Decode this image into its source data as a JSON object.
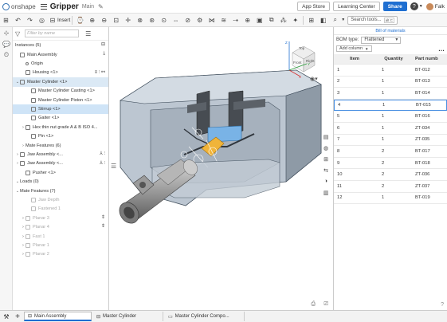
{
  "app": {
    "logo": "onshape",
    "doc_title": "Gripper",
    "branch": "Main"
  },
  "topbar": {
    "app_store": "App Store",
    "learning_center": "Learning Center",
    "share": "Share",
    "help": "?",
    "user": "Falk"
  },
  "toolbar": {
    "insert_label": "Insert",
    "search_placeholder": "Search tools...",
    "search_shortcut": "alt C"
  },
  "tree": {
    "header": "Instances (5)",
    "filter_placeholder": "Filter by name",
    "rows": [
      {
        "label": "Main Assembly",
        "indent": 0,
        "caret": "",
        "kind": "asm",
        "dim": false,
        "sel": false,
        "hl": false
      },
      {
        "label": "Origin",
        "indent": 1,
        "caret": "",
        "kind": "origin",
        "dim": false,
        "sel": false,
        "hl": false
      },
      {
        "label": "Housing <1>",
        "indent": 1,
        "caret": "",
        "kind": "part",
        "dim": false,
        "sel": false,
        "hl": false
      },
      {
        "label": "Master Cylinder <1>",
        "indent": 0,
        "caret": "v",
        "kind": "asm",
        "dim": false,
        "sel": false,
        "hl": true
      },
      {
        "label": "Master Cylinder Casting <1>",
        "indent": 2,
        "caret": "",
        "kind": "part",
        "dim": false,
        "sel": false,
        "hl": false
      },
      {
        "label": "Master Cylinder Piston <1>",
        "indent": 2,
        "caret": "",
        "kind": "part",
        "dim": false,
        "sel": false,
        "hl": false
      },
      {
        "label": "Stirrup <1>",
        "indent": 2,
        "caret": "",
        "kind": "part",
        "dim": false,
        "sel": true,
        "hl": false
      },
      {
        "label": "Gaiter <1>",
        "indent": 2,
        "caret": "",
        "kind": "part",
        "dim": false,
        "sel": false,
        "hl": false
      },
      {
        "label": "Hex thin nut grade A & B ISO 4...",
        "indent": 1,
        "caret": ">",
        "kind": "asm",
        "dim": false,
        "sel": false,
        "hl": false
      },
      {
        "label": "Pin <1>",
        "indent": 2,
        "caret": "",
        "kind": "part",
        "dim": false,
        "sel": false,
        "hl": false
      },
      {
        "label": "Mate Features (6)",
        "indent": 1,
        "caret": ">",
        "kind": "folder",
        "dim": false,
        "sel": false,
        "hl": false
      },
      {
        "label": "Jaw Assembly <...",
        "indent": 0,
        "caret": ">",
        "kind": "asm",
        "dim": false,
        "sel": false,
        "hl": false
      },
      {
        "label": "Jaw Assembly <...",
        "indent": 0,
        "caret": ">",
        "kind": "asm",
        "dim": false,
        "sel": false,
        "hl": false
      },
      {
        "label": "Pusher <1>",
        "indent": 1,
        "caret": "",
        "kind": "part",
        "dim": false,
        "sel": false,
        "hl": false
      },
      {
        "label": "Loads (0)",
        "indent": 0,
        "caret": "v",
        "kind": "folder",
        "dim": false,
        "sel": false,
        "hl": false
      },
      {
        "label": "Mate Features (7)",
        "indent": 0,
        "caret": "v",
        "kind": "folder",
        "dim": false,
        "sel": false,
        "hl": false
      },
      {
        "label": "Jaw Depth",
        "indent": 2,
        "caret": "",
        "kind": "mate",
        "dim": true,
        "sel": false,
        "hl": false
      },
      {
        "label": "Fastened 1",
        "indent": 2,
        "caret": "",
        "kind": "mate",
        "dim": true,
        "sel": false,
        "hl": false
      },
      {
        "label": "Planar 3",
        "indent": 1,
        "caret": ">",
        "kind": "mate",
        "dim": true,
        "sel": false,
        "hl": false
      },
      {
        "label": "Planar 4",
        "indent": 1,
        "caret": ">",
        "kind": "mate",
        "dim": true,
        "sel": false,
        "hl": false
      },
      {
        "label": "Fast 1",
        "indent": 1,
        "caret": ">",
        "kind": "mate",
        "dim": true,
        "sel": false,
        "hl": false
      },
      {
        "label": "Planar 1",
        "indent": 1,
        "caret": ">",
        "kind": "mate",
        "dim": true,
        "sel": false,
        "hl": false
      },
      {
        "label": "Planar 2",
        "indent": 1,
        "caret": ">",
        "kind": "mate",
        "dim": true,
        "sel": false,
        "hl": false
      }
    ]
  },
  "viewcube": {
    "front": "Front",
    "top": "Top",
    "right": "Right",
    "x": "X",
    "y": "Y",
    "z": "Z"
  },
  "bom": {
    "title": "Bill of materials",
    "type_label": "BOM type:",
    "type_value": "Flattened",
    "add_column": "Add column",
    "cols": [
      "Item",
      "Quantity",
      "Part numb"
    ],
    "rows": [
      {
        "item": "1",
        "qty": "1",
        "part": "BT-012",
        "sel": false
      },
      {
        "item": "2",
        "qty": "1",
        "part": "BT-013",
        "sel": false
      },
      {
        "item": "3",
        "qty": "1",
        "part": "BT-014",
        "sel": false
      },
      {
        "item": "4",
        "qty": "1",
        "part": "BT-015",
        "sel": true
      },
      {
        "item": "5",
        "qty": "1",
        "part": "BT-016",
        "sel": false
      },
      {
        "item": "6",
        "qty": "1",
        "part": "ZT-034",
        "sel": false
      },
      {
        "item": "7",
        "qty": "1",
        "part": "ZT-035",
        "sel": false
      },
      {
        "item": "8",
        "qty": "2",
        "part": "BT-017",
        "sel": false
      },
      {
        "item": "9",
        "qty": "2",
        "part": "BT-018",
        "sel": false
      },
      {
        "item": "10",
        "qty": "2",
        "part": "ZT-036",
        "sel": false
      },
      {
        "item": "11",
        "qty": "2",
        "part": "ZT-037",
        "sel": false
      },
      {
        "item": "12",
        "qty": "1",
        "part": "BT-019",
        "sel": false
      }
    ]
  },
  "tabs": [
    {
      "label": "Main Assembly",
      "active": true
    },
    {
      "label": "Master Cylinder",
      "active": false
    },
    {
      "label": "Master Cylinder Compo...",
      "active": false
    }
  ]
}
